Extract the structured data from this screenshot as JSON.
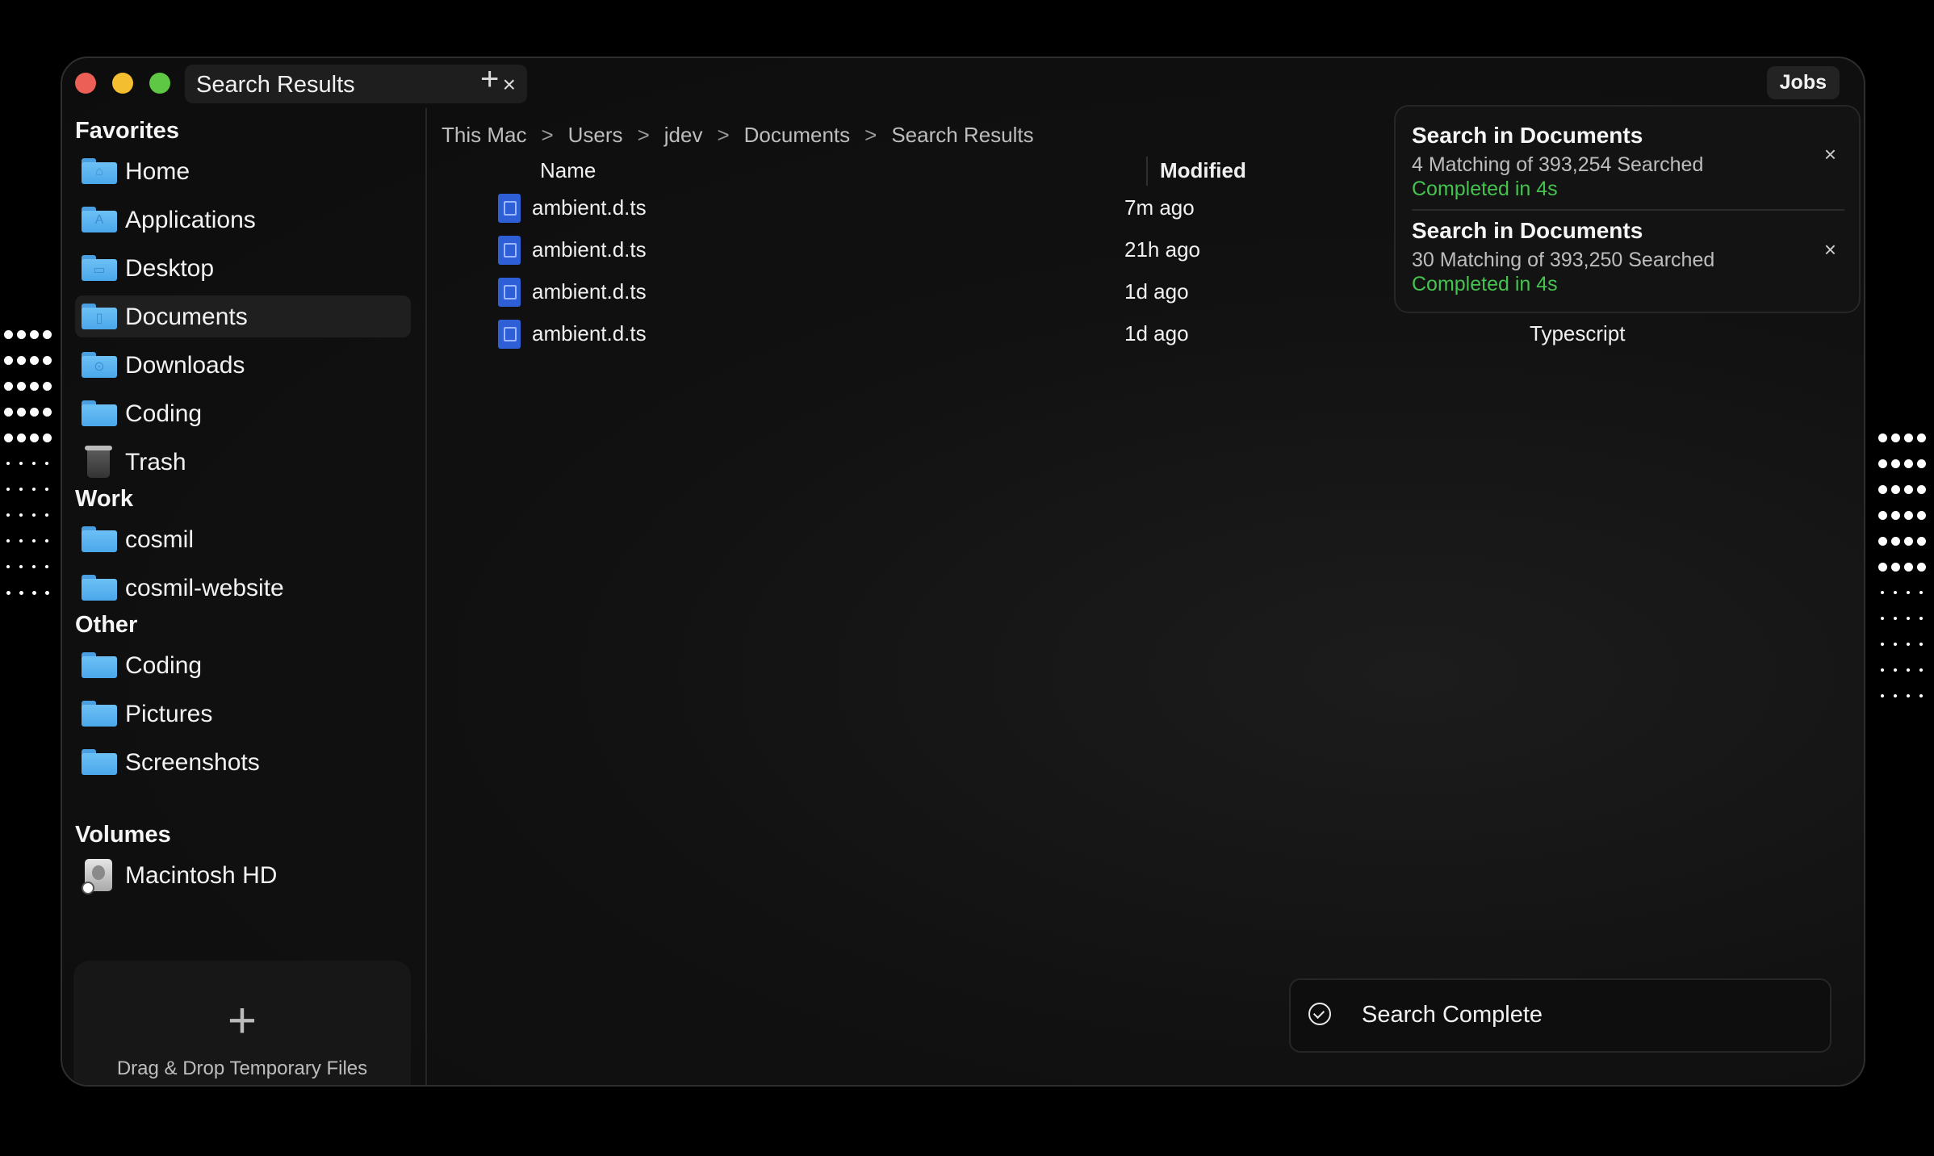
{
  "window": {
    "tab_title": "Search Results",
    "tab_close": "×",
    "new_tab": "+",
    "jobs_label": "Jobs"
  },
  "sidebar": {
    "favorites_title": "Favorites",
    "favorites": [
      {
        "label": "Home",
        "icon": "home-folder-icon"
      },
      {
        "label": "Applications",
        "icon": "applications-folder-icon"
      },
      {
        "label": "Desktop",
        "icon": "desktop-folder-icon"
      },
      {
        "label": "Documents",
        "icon": "documents-folder-icon",
        "selected": true
      },
      {
        "label": "Downloads",
        "icon": "downloads-folder-icon"
      },
      {
        "label": "Coding",
        "icon": "folder-icon"
      },
      {
        "label": "Trash",
        "icon": "trash-icon"
      }
    ],
    "work_title": "Work",
    "work": [
      {
        "label": "cosmil",
        "icon": "folder-icon"
      },
      {
        "label": "cosmil-website",
        "icon": "folder-icon"
      }
    ],
    "other_title": "Other",
    "other": [
      {
        "label": "Coding",
        "icon": "folder-icon"
      },
      {
        "label": "Pictures",
        "icon": "folder-icon"
      },
      {
        "label": "Screenshots",
        "icon": "folder-icon"
      }
    ],
    "volumes_title": "Volumes",
    "volumes": [
      {
        "label": "Macintosh HD",
        "icon": "hard-drive-icon"
      }
    ],
    "dropzone_plus": "+",
    "dropzone_text": "Drag & Drop Temporary Files"
  },
  "breadcrumb": {
    "items": [
      "This Mac",
      "Users",
      "jdev",
      "Documents",
      "Search Results"
    ],
    "separator": ">"
  },
  "table": {
    "columns": {
      "name": "Name",
      "modified": "Modified"
    },
    "rows": [
      {
        "name": "ambient.d.ts",
        "modified": "7m ago"
      },
      {
        "name": "ambient.d.ts",
        "modified": "21h ago"
      },
      {
        "name": "ambient.d.ts",
        "modified": "1d ago"
      },
      {
        "name": "ambient.d.ts",
        "modified": "1d ago"
      }
    ],
    "visible_kind": "Typescript"
  },
  "jobs": [
    {
      "title": "Search in Documents",
      "subtitle": "4 Matching of 393,254 Searched",
      "status": "Completed in 4s",
      "close": "×"
    },
    {
      "title": "Search in Documents",
      "subtitle": "30 Matching of 393,250 Searched",
      "status": "Completed in 4s",
      "close": "×"
    }
  ],
  "toast": {
    "text": "Search Complete"
  },
  "colors": {
    "accent_green": "#46c24f",
    "folder_blue": "#5bb3f0",
    "file_icon_blue": "#2f5fd6"
  }
}
